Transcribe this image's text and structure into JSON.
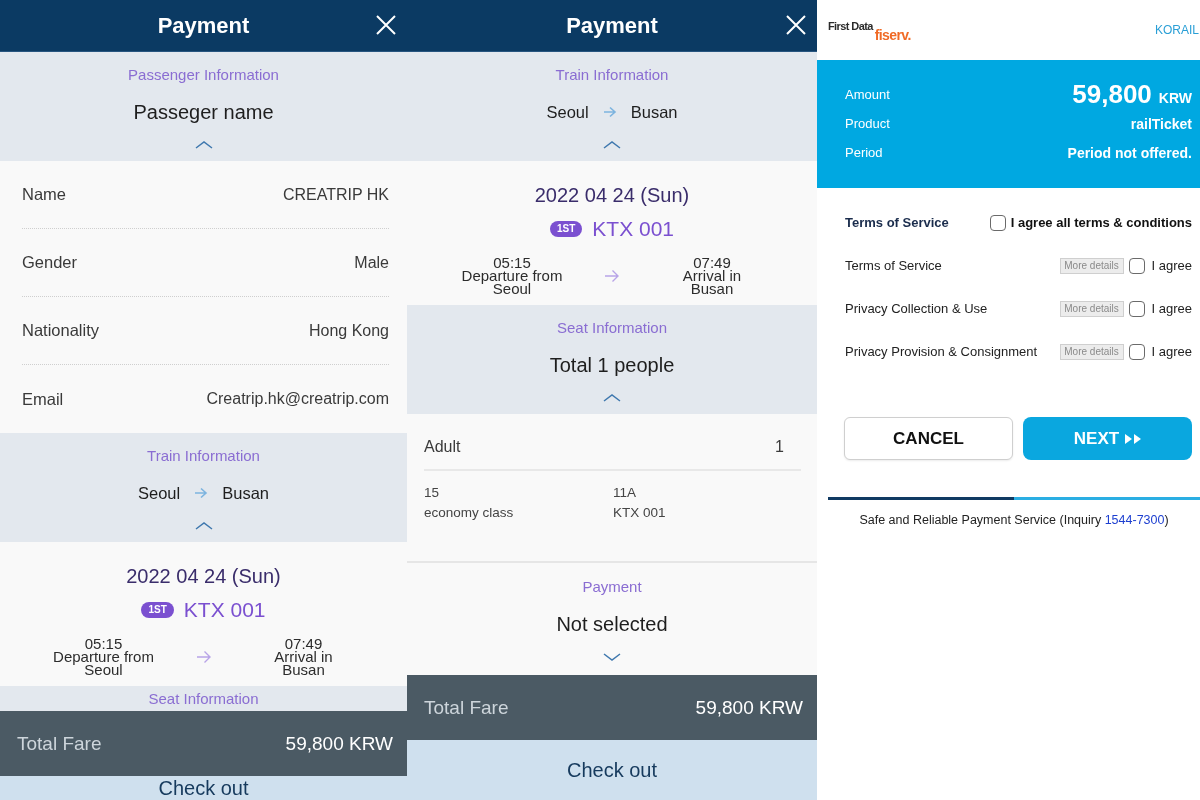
{
  "panels": [
    {
      "kind": "app",
      "header": {
        "title": "Payment"
      },
      "sections": [
        {
          "kind": "band",
          "label": "Passenger Information",
          "title": "Passeger name",
          "expanded": true
        },
        {
          "kind": "fields",
          "rows": [
            {
              "label": "Name",
              "value": "CREATRIP HK"
            },
            {
              "label": "Gender",
              "value": "Male"
            },
            {
              "label": "Nationality",
              "value": "Hong Kong"
            },
            {
              "label": "Email",
              "value": "Creatrip.hk@creatrip.com"
            }
          ]
        },
        {
          "kind": "band",
          "label": "Train Information",
          "route": {
            "from": "Seoul",
            "to": "Busan"
          },
          "expanded": true
        },
        {
          "kind": "train",
          "date": "2022 04 24 (Sun)",
          "class": "1ST",
          "train": "KTX 001",
          "departure": {
            "time": "05:15",
            "label": "Departure from",
            "station": "Seoul"
          },
          "arrival": {
            "time": "07:49",
            "label": "Arrival in",
            "station": "Busan"
          }
        },
        {
          "kind": "band",
          "label": "Seat Information"
        }
      ],
      "total": {
        "label": "Total Fare",
        "value": "59,800 KRW"
      },
      "checkout": {
        "label": "Check out"
      }
    },
    {
      "kind": "app",
      "header": {
        "title": "Payment"
      },
      "sections": [
        {
          "kind": "band",
          "label": "Train Information",
          "route": {
            "from": "Seoul",
            "to": "Busan"
          },
          "expanded": true
        },
        {
          "kind": "train",
          "date": "2022 04 24 (Sun)",
          "class": "1ST",
          "train": "KTX 001",
          "departure": {
            "time": "05:15",
            "label": "Departure from",
            "station": "Seoul"
          },
          "arrival": {
            "time": "07:49",
            "label": "Arrival in",
            "station": "Busan"
          }
        },
        {
          "kind": "band",
          "label": "Seat Information",
          "title": "Total 1 people",
          "expanded": true
        },
        {
          "kind": "seats",
          "rows": [
            {
              "label": "Adult",
              "value": "1"
            }
          ],
          "cells": [
            {
              "lines": [
                "15",
                "economy class"
              ]
            },
            {
              "lines": [
                "11A",
                "KTX 001"
              ]
            }
          ]
        },
        {
          "kind": "band",
          "label": "Payment",
          "title": "Not selected",
          "expanded": false
        }
      ],
      "total": {
        "label": "Total Fare",
        "value": "59,800 KRW"
      },
      "checkout": {
        "label": "Check out"
      }
    },
    {
      "kind": "gateway",
      "brand": {
        "name": "First Data",
        "sub": "fiserv."
      },
      "merchant": "KORAIL",
      "summary": [
        {
          "label": "Amount",
          "value": "59,800",
          "unit": "KRW"
        },
        {
          "label": "Product",
          "value": "railTicket"
        },
        {
          "label": "Period",
          "value": "Period not offered."
        }
      ],
      "terms": {
        "title": "Terms of Service",
        "agree_all": {
          "label": "I agree all terms & conditions",
          "checked": false
        },
        "items": [
          {
            "label": "Terms of Service",
            "details": "More details",
            "agree": "I agree",
            "checked": false
          },
          {
            "label": "Privacy Collection & Use",
            "details": "More details",
            "agree": "I agree",
            "checked": false
          },
          {
            "label": "Privacy Provision & Consignment",
            "details": "More details",
            "agree": "I agree",
            "checked": false
          }
        ]
      },
      "buttons": [
        {
          "label": "CANCEL",
          "kind": "secondary"
        },
        {
          "label": "NEXT",
          "kind": "primary"
        }
      ],
      "progress": {
        "level": 0.5
      },
      "footer": {
        "text": "Safe and Reliable Payment Service (Inquiry ",
        "link": "1544-7300",
        "after": ")"
      }
    }
  ]
}
